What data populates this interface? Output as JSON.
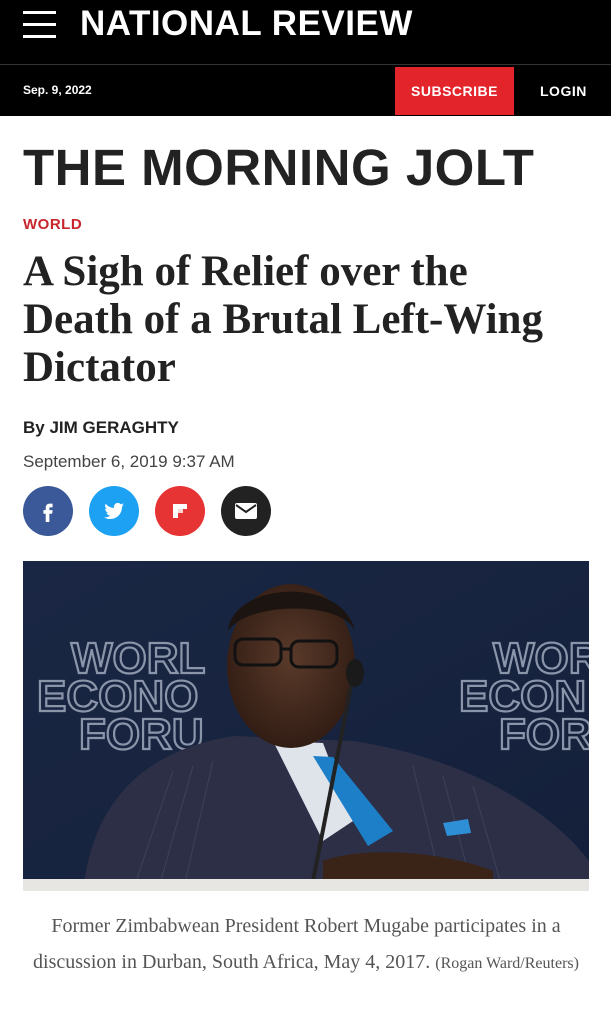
{
  "header": {
    "brand": "NATIONAL REVIEW",
    "menu_icon": "hamburger-menu-icon"
  },
  "subbar": {
    "date": "Sep. 9, 2022",
    "subscribe_label": "SUBSCRIBE",
    "login_label": "LOGIN",
    "accent_color": "#e3242b"
  },
  "article": {
    "section": "THE MORNING JOLT",
    "category": "WORLD",
    "headline": "A Sigh of Relief over the Death of a Brutal Left-Wing Dictator",
    "byline_prefix": "By",
    "author": "JIM GERAGHTY",
    "published": "September 6, 2019 9:37 AM",
    "share_icons": [
      "facebook-icon",
      "twitter-icon",
      "flipboard-icon",
      "email-icon"
    ],
    "image": {
      "backdrop_text_left": [
        "WORL",
        "ECONO",
        "FORU"
      ],
      "backdrop_text_right": [
        "WOR",
        "ECON",
        "FOR"
      ]
    },
    "caption": "Former Zimbabwean President Robert Mugabe participates in a discussion in Durban, South Africa, May 4, 2017.",
    "credit": "(Rogan Ward/Reuters)"
  }
}
